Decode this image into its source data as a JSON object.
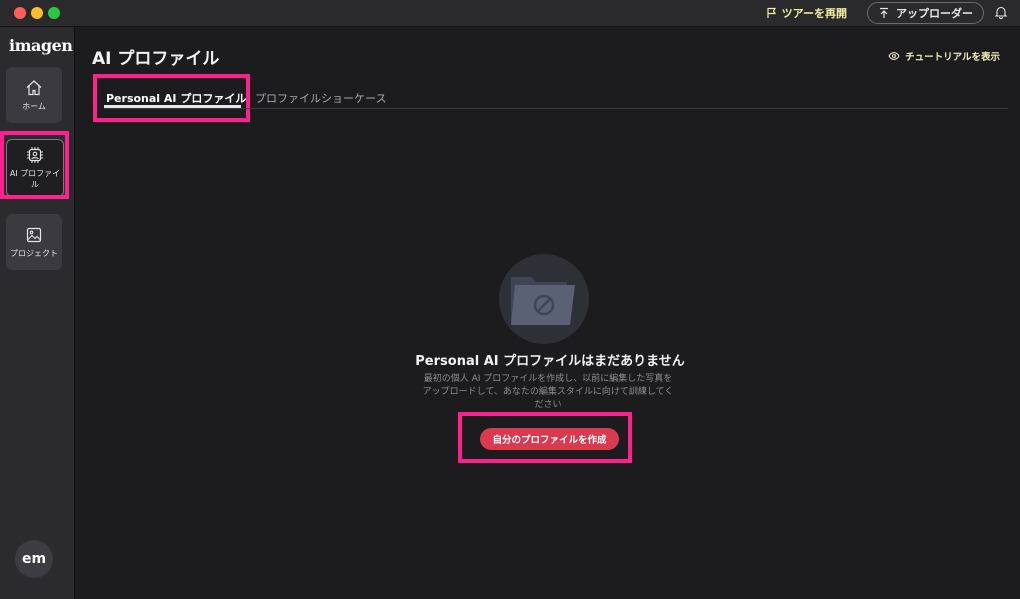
{
  "titlebar": {
    "tour_label": "ツアーを再開",
    "uploader_label": "アップローダー"
  },
  "sidebar": {
    "logo": "imagen",
    "items": [
      {
        "label": "ホーム",
        "icon": "home-icon"
      },
      {
        "label": "AI プロファイル",
        "icon": "ai-profile-icon"
      },
      {
        "label": "プロジェクト",
        "icon": "image-icon"
      }
    ],
    "avatar": "em"
  },
  "main": {
    "title": "AI プロファイル",
    "tutorial_label": "チュートリアルを表示",
    "tabs": [
      {
        "label": "Personal AI プロファイル",
        "active": true
      },
      {
        "label": "プロファイルショーケース",
        "active": false
      }
    ],
    "empty": {
      "title": "Personal AI プロファイルはまだありません",
      "description": "最初の個人 AI プロファイルを作成し、以前に編集した写真をアップロードして、あなたの編集スタイルに向けて訓練してください",
      "button": "自分のプロファイルを作成"
    }
  },
  "colors": {
    "accent": "#d93a50",
    "highlight": "#ff1f8e",
    "tour_text": "#f5f0a0"
  }
}
